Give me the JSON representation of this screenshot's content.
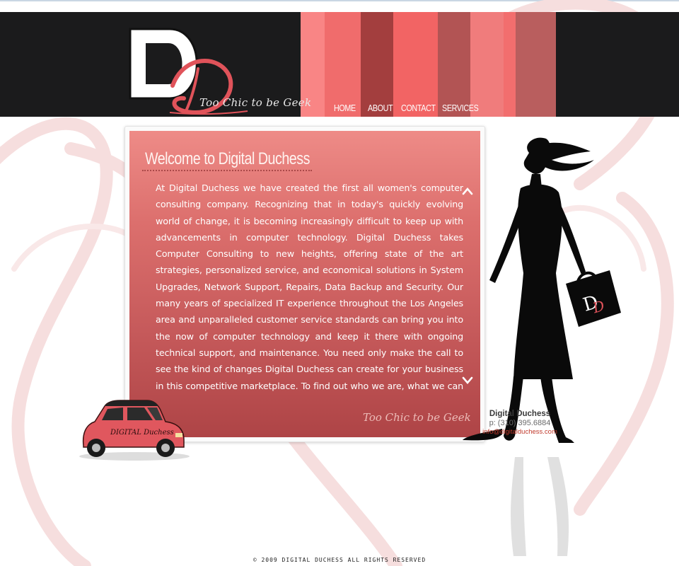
{
  "colors": {
    "header_bg": "#1b1b1c",
    "accent": "#e8706e",
    "panel_top": "#ee8b87",
    "panel_bottom": "#ae4446",
    "email": "#c0392b"
  },
  "header": {
    "logo_text": "DD",
    "tagline": "Too Chic to be Geek",
    "stripes": [
      "#f98585",
      "#f06c6c",
      "#a33e3e",
      "#f26464",
      "#b25454",
      "#f07c7c",
      "#f26e6e",
      "#b95e5e"
    ]
  },
  "nav": {
    "items": [
      {
        "label": "HOME"
      },
      {
        "label": "ABOUT"
      },
      {
        "label": "CONTACT"
      },
      {
        "label": "SERVICES"
      }
    ]
  },
  "main": {
    "title": "Welcome to Digital Duchess",
    "body": "At Digital Duchess we have created the first all women's computer consulting company. Recognizing that in today's quickly evolving world of change, it is becoming increasingly difficult to keep up with advancements in computer technology. Digital Duchess takes Computer Consulting to new heights, offering state of the art strategies, personalized service, and economical solutions in System Upgrades, Network Support, Repairs, Data Backup and Security. Our many years of specialized IT experience throughout the Los Angeles area and unparalleled customer service standards can bring you into the now of computer technology and keep it there with ongoing technical support, and maintenance. You need only make the call to see the kind of changes Digital Duchess can create for your business in this competitive marketplace. To find out who we are, what we can do, and how to reach us, click the appropriate icon on the right. Align yourself with Digital Duchess and",
    "footer_tag": "Too Chic to be Geek",
    "scroll_up_icon": "chevron-up-icon",
    "scroll_down_icon": "chevron-down-icon"
  },
  "car": {
    "brand_text": "DIGITAL Duchess"
  },
  "contact": {
    "name": "Digital Duchess",
    "phone": "p: (310) 395.6884",
    "email": "info@digitalduchess.com"
  },
  "footer": {
    "copyright": "© 2009  DIGITAL DUCHESS  ALL RIGHTS RESERVED"
  }
}
